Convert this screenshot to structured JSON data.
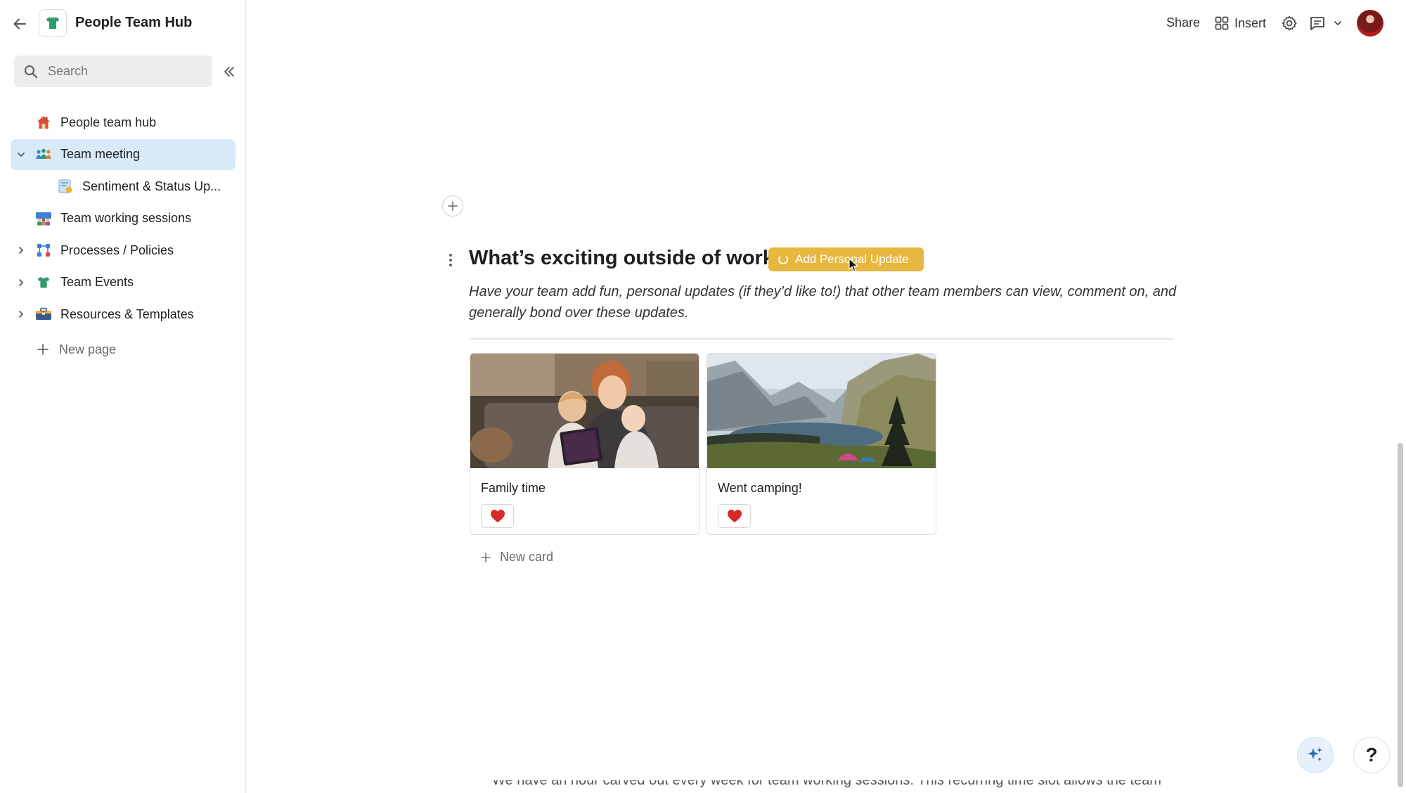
{
  "doc": {
    "title": "People Team Hub",
    "back_icon": "back-arrow-icon",
    "logo_icon": "t-shirt-icon"
  },
  "search": {
    "placeholder": "Search",
    "icon": "search-icon"
  },
  "sidebar": {
    "collapse_icon": "double-chevron-left-icon",
    "items": [
      {
        "label": "People team hub",
        "icon": "house-icon",
        "expandable": false,
        "active": false
      },
      {
        "label": "Team meeting",
        "icon": "people-icon",
        "expandable": true,
        "expanded": true,
        "active": true
      },
      {
        "label": "Sentiment & Status Up...",
        "icon": "status-report-icon",
        "expandable": false,
        "active": false,
        "child": true
      },
      {
        "label": "Team working sessions",
        "icon": "team-icon",
        "expandable": false,
        "active": false
      },
      {
        "label": "Processes / Policies",
        "icon": "flowchart-icon",
        "expandable": true,
        "active": false
      },
      {
        "label": "Team Events",
        "icon": "t-shirt-icon",
        "expandable": true,
        "active": false
      },
      {
        "label": "Resources & Templates",
        "icon": "toolbox-icon",
        "expandable": true,
        "active": false
      }
    ],
    "new_page_label": "New page"
  },
  "topbar": {
    "share_label": "Share",
    "insert_label": "Insert",
    "settings_icon": "gear-icon",
    "comment_icon": "comment-icon",
    "avatar": "user-avatar"
  },
  "main": {
    "heading": "What’s exciting outside of work?",
    "personal_button_label": "Add Personal Update",
    "description": "Have your team add fun, personal updates (if they’d like to!) that other team members can view, comment on, and generally bond over these updates.",
    "cards": [
      {
        "title": "Family time",
        "image": "family-photo",
        "reaction_icon": "heart-icon"
      },
      {
        "title": "Went camping!",
        "image": "mountain-lake-photo",
        "reaction_icon": "heart-icon"
      }
    ],
    "new_card_label": "New card",
    "bottom_peek_text": "We have an hour carved out every week for team working sessions. This recurring time slot allows the team"
  },
  "floating": {
    "ai_icon": "sparkle-icon",
    "help_label": "?"
  },
  "colors": {
    "active_nav_bg": "#d8e9f8",
    "personal_button_bg": "#e8b740",
    "heart": "#d42a2a"
  }
}
